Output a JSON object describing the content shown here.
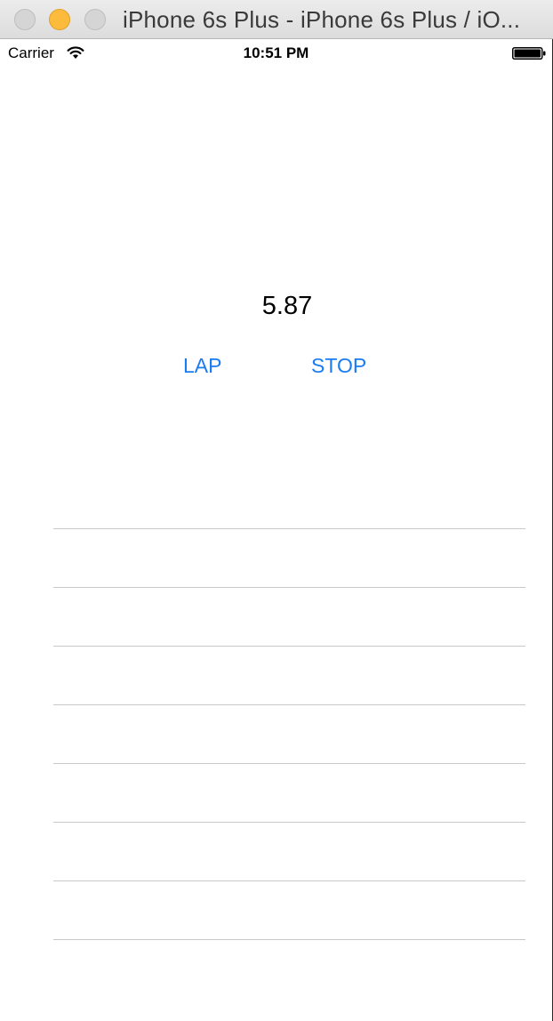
{
  "window": {
    "title": "iPhone 6s Plus - iPhone 6s Plus / iO..."
  },
  "status_bar": {
    "carrier": "Carrier",
    "time": "10:51 PM",
    "wifi_icon": "wifi-icon",
    "battery_icon": "battery-full-icon"
  },
  "stopwatch": {
    "elapsed": "5.87",
    "lap_label": "LAP",
    "stop_label": "STOP"
  },
  "colors": {
    "accent": "#1a7cf4",
    "separator": "#c8c7cc",
    "minimize": "#fcbb3c"
  },
  "laps": {
    "rows": [
      "",
      "",
      "",
      "",
      "",
      "",
      "",
      ""
    ]
  }
}
